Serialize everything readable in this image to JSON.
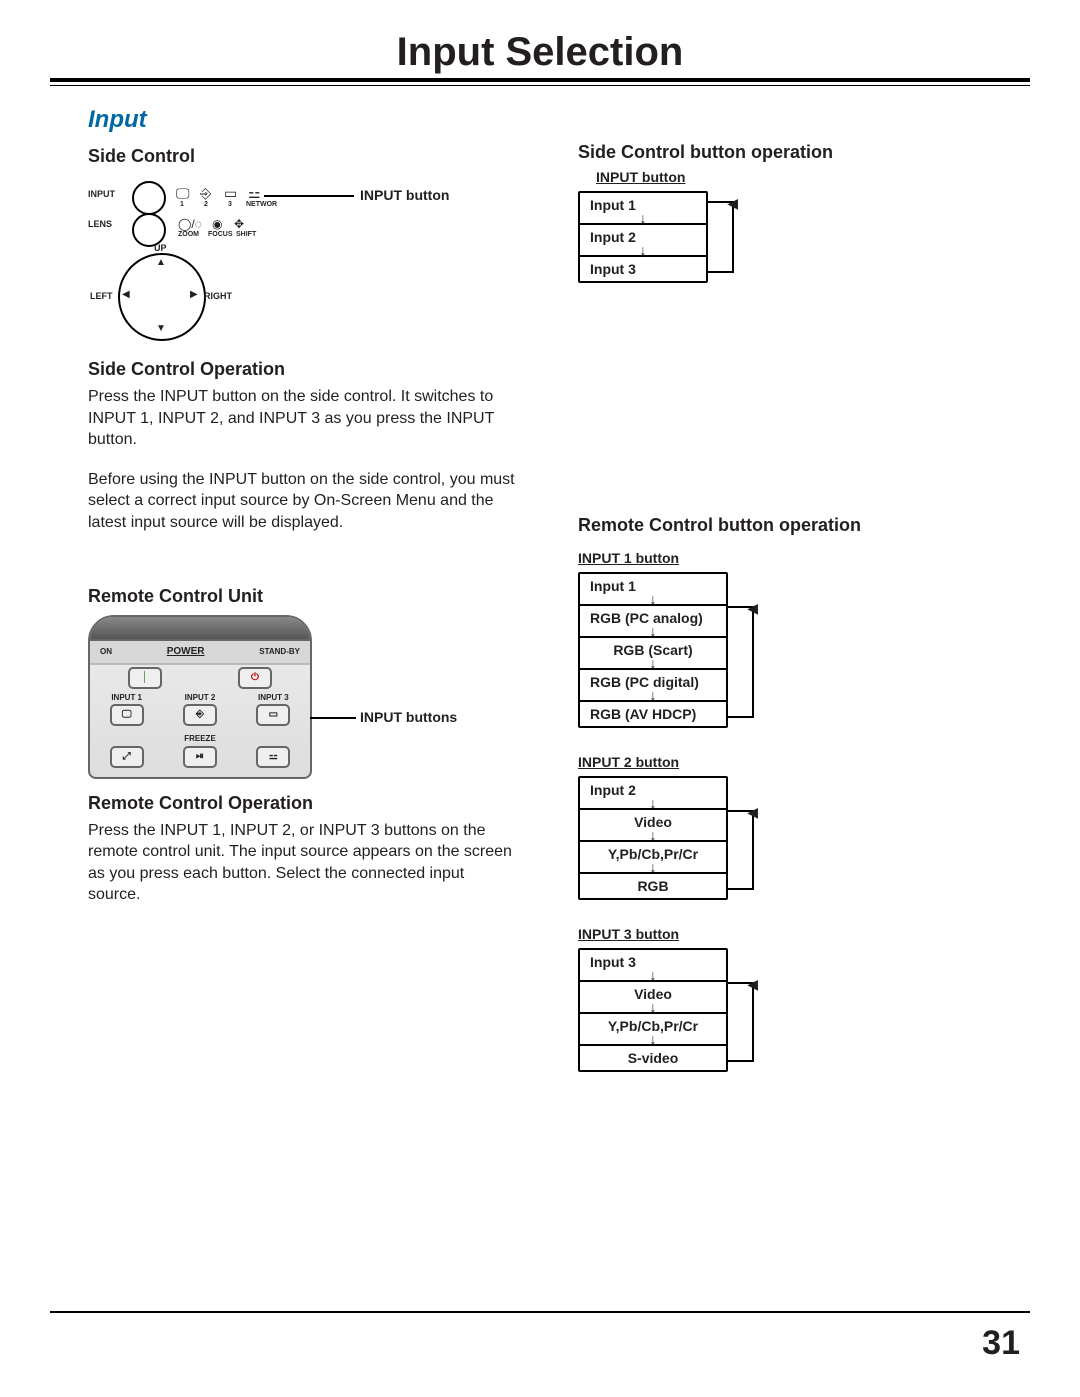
{
  "page": {
    "title": "Input Selection",
    "number": "31"
  },
  "section": {
    "heading": "Input"
  },
  "left": {
    "sideControl": {
      "heading": "Side Control",
      "callout": "INPUT button",
      "labels": {
        "input": "INPUT",
        "lens": "LENS",
        "zoom": "ZOOM",
        "focus": "FOCUS",
        "shift": "SHIFT",
        "up": "UP",
        "left": "LEFT",
        "right": "RIGHT",
        "idx1": "1",
        "idx2": "2",
        "idx3": "3",
        "network": "NETWOR"
      }
    },
    "sideOp": {
      "heading": "Side Control Operation",
      "p1": "Press the INPUT button on the side control. It switches to INPUT 1, INPUT 2, and INPUT 3 as you press the INPUT button.",
      "p2": "Before using the INPUT button on the side control, you must select a correct input source by On-Screen Menu and the latest input source will be displayed."
    },
    "remoteUnit": {
      "heading": "Remote Control Unit",
      "callout": "INPUT buttons",
      "labels": {
        "on": "ON",
        "standby": "STAND-BY",
        "power": "POWER",
        "input1": "INPUT 1",
        "input2": "INPUT 2",
        "input3": "INPUT 3",
        "freeze": "FREEZE",
        "autopc": "AUTO PC",
        "network": "NETWORK"
      }
    },
    "remoteOp": {
      "heading": "Remote Control Operation",
      "p1": "Press the INPUT 1, INPUT 2, or INPUT 3 buttons on the remote control unit. The input source appears on the screen as you press each button. Select the connected input source."
    }
  },
  "right": {
    "sideBtn": {
      "heading": "Side Control button operation",
      "sub": "INPUT button",
      "items": [
        "Input 1",
        "Input 2",
        "Input 3"
      ]
    },
    "remoteBtn": {
      "heading": "Remote Control button operation",
      "groups": [
        {
          "sub": "INPUT 1 button",
          "first": "Input 1",
          "cycle": [
            "RGB (PC analog)",
            "RGB (Scart)",
            "RGB (PC digital)",
            "RGB (AV HDCP)"
          ]
        },
        {
          "sub": "INPUT 2 button",
          "first": "Input 2",
          "cycle": [
            "Video",
            "Y,Pb/Cb,Pr/Cr",
            "RGB"
          ]
        },
        {
          "sub": "INPUT 3 button",
          "first": "Input 3",
          "cycle": [
            "Video",
            "Y,Pb/Cb,Pr/Cr",
            "S-video"
          ]
        }
      ]
    }
  }
}
